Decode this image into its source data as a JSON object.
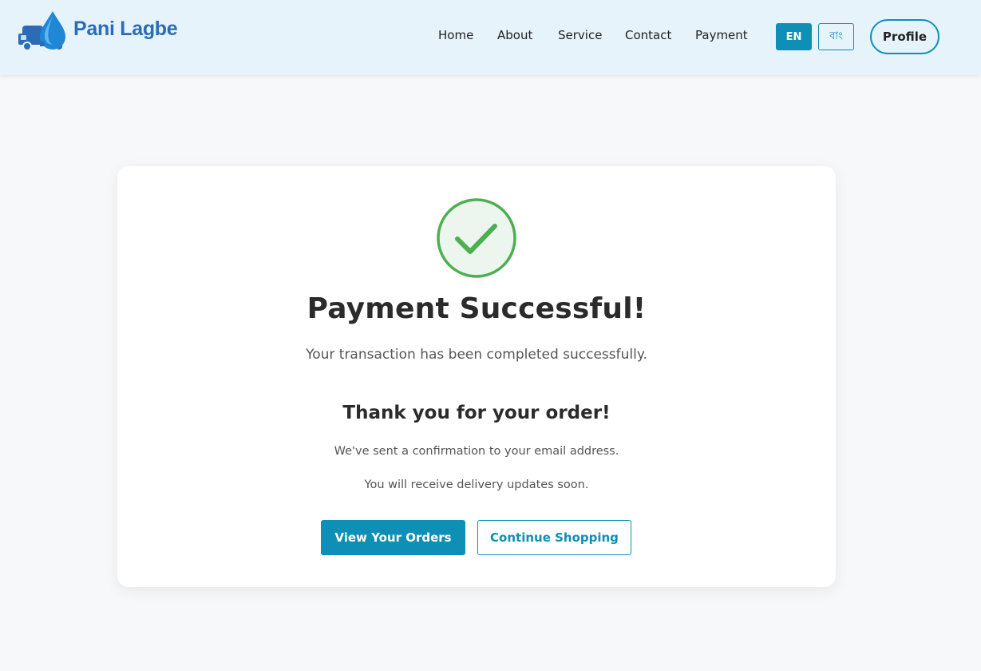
{
  "brand": {
    "name": "Pani Lagbe",
    "logo_icon": "water-truck-icon",
    "color": "#2a6cb5"
  },
  "nav": {
    "links": [
      {
        "label": "Home"
      },
      {
        "label": "About"
      },
      {
        "label": "Service"
      },
      {
        "label": "Contact"
      },
      {
        "label": "Payment"
      }
    ],
    "lang_en": "EN",
    "lang_bn": "বাং",
    "active_lang": "EN",
    "profile_label": "Profile"
  },
  "colors": {
    "accent": "#0e8fb5",
    "success": "#4caf50",
    "navbar_bg": "#e6f3fb"
  },
  "status": {
    "icon": "check-circle-icon",
    "title": "Payment Successful!",
    "subtitle": "Your transaction has been completed successfully.",
    "thanks": "Thank you for your order!",
    "info_email": "We've sent a confirmation to your email address.",
    "info_delivery": "You will receive delivery updates soon."
  },
  "actions": {
    "view_orders": "View Your Orders",
    "continue_shopping": "Continue Shopping"
  }
}
